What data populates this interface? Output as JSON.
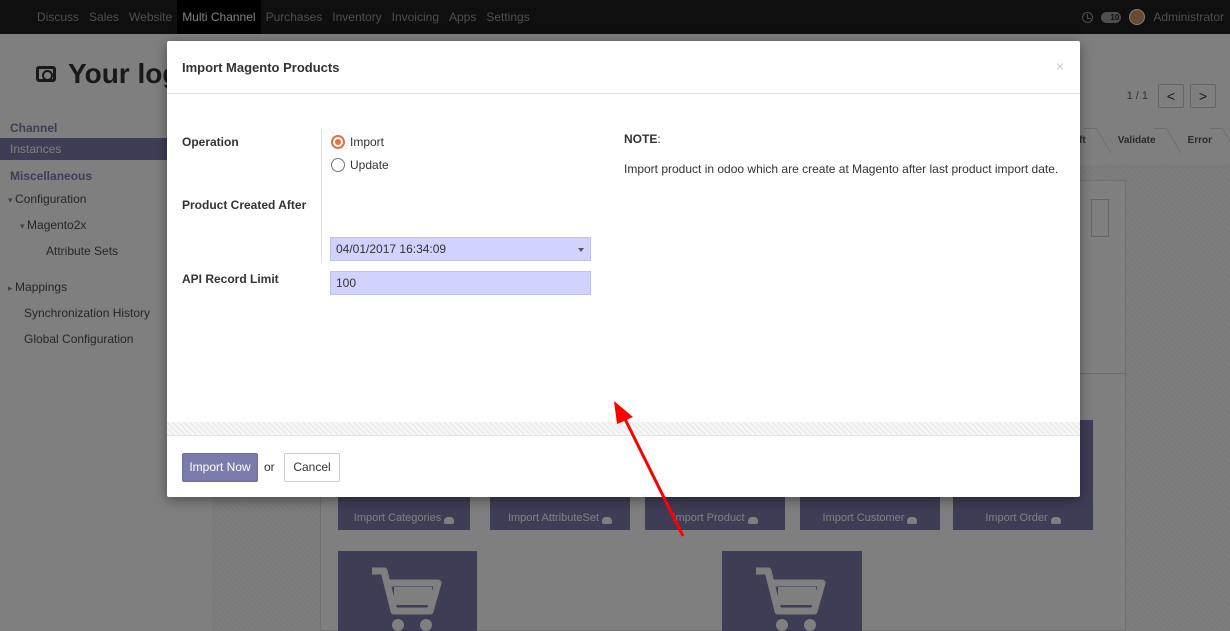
{
  "topbar": {
    "menu": [
      "Discuss",
      "Sales",
      "Website",
      "Multi Channel",
      "Purchases",
      "Inventory",
      "Invoicing",
      "Apps",
      "Settings"
    ],
    "active": "Multi Channel",
    "chat_count": "10",
    "user": "Administrator"
  },
  "logo_text": "Your log",
  "sidebar": {
    "channel_header": "Channel",
    "instances": "Instances",
    "misc_header": "Miscellaneous",
    "configuration": "Configuration",
    "magento2x": "Magento2x",
    "attribute_sets": "Attribute Sets",
    "mappings": "Mappings",
    "sync_history": "Synchronization History",
    "global_config": "Global Configuration"
  },
  "pager": {
    "count": "1 / 1",
    "prev": "<",
    "next": ">"
  },
  "statusbar": [
    "ft",
    "Validate",
    "Error"
  ],
  "tiles": {
    "import_categories": "Import Categories",
    "import_attributeset": "Import AttributeSet",
    "import_product": "Import Product",
    "import_customer": "Import Customer",
    "import_order": "Import Order"
  },
  "modal": {
    "title": "Import Magento Products",
    "close": "×",
    "operation_label": "Operation",
    "options": [
      "Import",
      "Update"
    ],
    "selected": "Import",
    "created_after_label": "Product Created After",
    "created_after_value": "04/01/2017 16:34:09",
    "limit_label": "API Record Limit",
    "limit_value": "100",
    "note_title": "NOTE",
    "note_colon": ":",
    "note_text": "Import product in odoo which are create at Magento after last product import date.",
    "import_now": "Import Now",
    "or": "or",
    "cancel": "Cancel"
  },
  "colors": {
    "accent": "#7c7bad",
    "radio": "#e66e45",
    "field_bg": "#d2d2ff",
    "arrow": "#ff0000"
  }
}
